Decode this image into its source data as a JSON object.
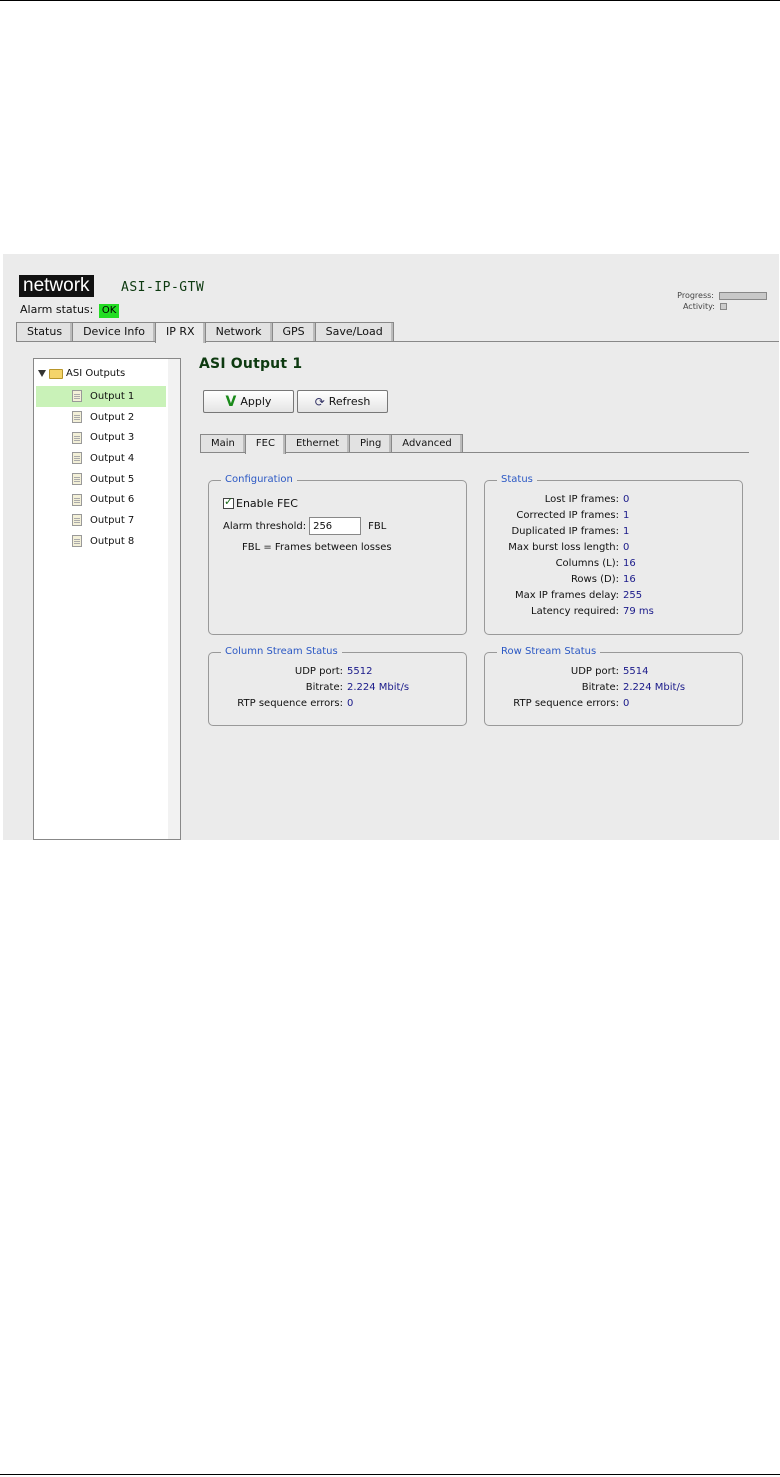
{
  "header": {
    "logo_text": "network",
    "device_name": "ASI-IP-GTW",
    "alarm_label": "Alarm status:",
    "alarm_value": "OK",
    "progress_label": "Progress:",
    "activity_label": "Activity:"
  },
  "tabs": [
    "Status",
    "Device Info",
    "IP RX",
    "Network",
    "GPS",
    "Save/Load"
  ],
  "active_tab": "IP RX",
  "tree": {
    "root_label": "ASI Outputs",
    "items": [
      "Output 1",
      "Output 2",
      "Output 3",
      "Output 4",
      "Output 5",
      "Output 6",
      "Output 7",
      "Output 8"
    ],
    "selected": "Output 1"
  },
  "content": {
    "title": "ASI Output 1",
    "apply_label": "Apply",
    "refresh_label": "Refresh",
    "subtabs": [
      "Main",
      "FEC",
      "Ethernet",
      "Ping",
      "Advanced"
    ],
    "active_subtab": "FEC"
  },
  "configuration": {
    "title": "Configuration",
    "enable_fec_label": "Enable FEC",
    "enable_fec_checked": true,
    "alarm_threshold_label": "Alarm threshold:",
    "alarm_threshold_value": "256",
    "alarm_threshold_unit": "FBL",
    "fbl_note": "FBL = Frames between losses"
  },
  "status": {
    "title": "Status",
    "rows": [
      {
        "label": "Lost IP frames:",
        "value": "0"
      },
      {
        "label": "Corrected IP frames:",
        "value": "1"
      },
      {
        "label": "Duplicated IP frames:",
        "value": "1"
      },
      {
        "label": "Max burst loss length:",
        "value": "0"
      },
      {
        "label": "Columns (L):",
        "value": "16"
      },
      {
        "label": "Rows (D):",
        "value": "16"
      },
      {
        "label": "Max IP frames delay:",
        "value": "255"
      },
      {
        "label": "Latency required:",
        "value": "79 ms"
      }
    ]
  },
  "column_stream": {
    "title": "Column Stream Status",
    "rows": [
      {
        "label": "UDP port:",
        "value": "5512"
      },
      {
        "label": "Bitrate:",
        "value": "2.224 Mbit/s"
      },
      {
        "label": "RTP sequence errors:",
        "value": "0"
      }
    ]
  },
  "row_stream": {
    "title": "Row Stream Status",
    "rows": [
      {
        "label": "UDP port:",
        "value": "5514"
      },
      {
        "label": "Bitrate:",
        "value": "2.224 Mbit/s"
      },
      {
        "label": "RTP sequence errors:",
        "value": "0"
      }
    ]
  }
}
